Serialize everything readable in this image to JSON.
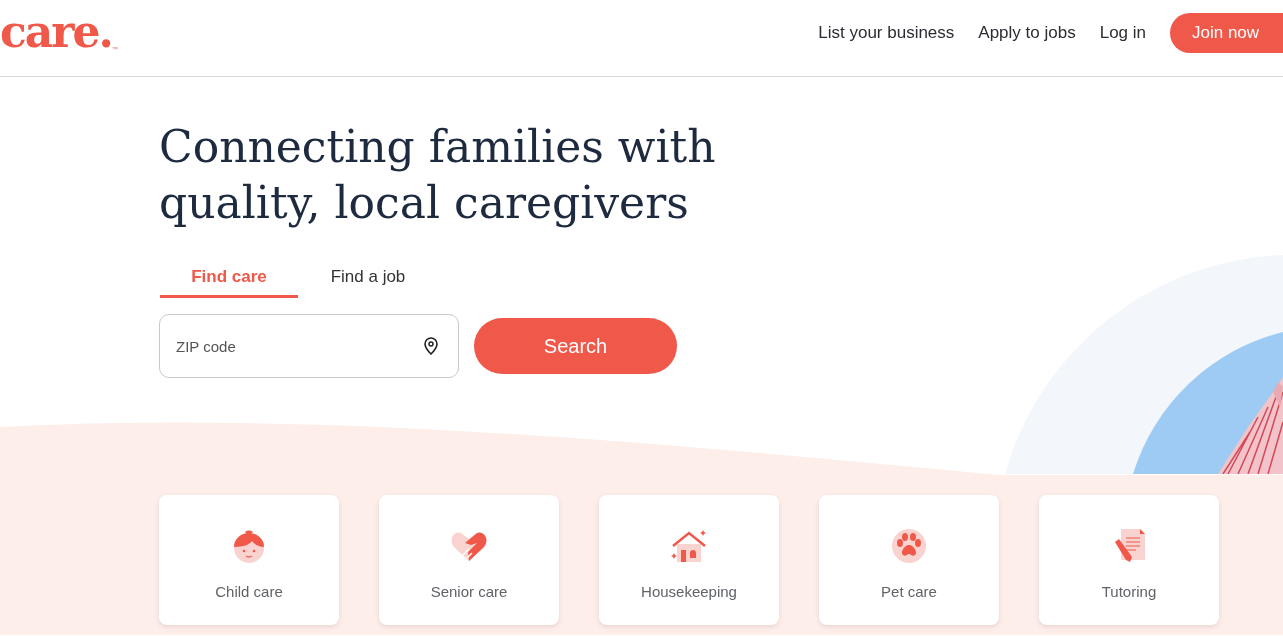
{
  "logo": {
    "text": "care.",
    "trademark": "™"
  },
  "nav": [
    {
      "label": "List your business",
      "kind": "link"
    },
    {
      "label": "Apply to jobs",
      "kind": "link"
    },
    {
      "label": "Log in",
      "kind": "link"
    },
    {
      "label": "Join now",
      "kind": "button"
    }
  ],
  "hero": {
    "heading": "Connecting families with quality, local caregivers",
    "tabs": [
      {
        "label": "Find care",
        "selected": true
      },
      {
        "label": "Find a job",
        "selected": false
      }
    ],
    "zip_field": {
      "placeholder": "ZIP code"
    },
    "search_button": "Search"
  },
  "categories": [
    {
      "label": "Child care",
      "kind": "child"
    },
    {
      "label": "Senior care",
      "kind": "senior"
    },
    {
      "label": "Housekeeping",
      "kind": "house"
    },
    {
      "label": "Pet care",
      "kind": "pet"
    },
    {
      "label": "Tutoring",
      "kind": "tutor"
    }
  ]
}
